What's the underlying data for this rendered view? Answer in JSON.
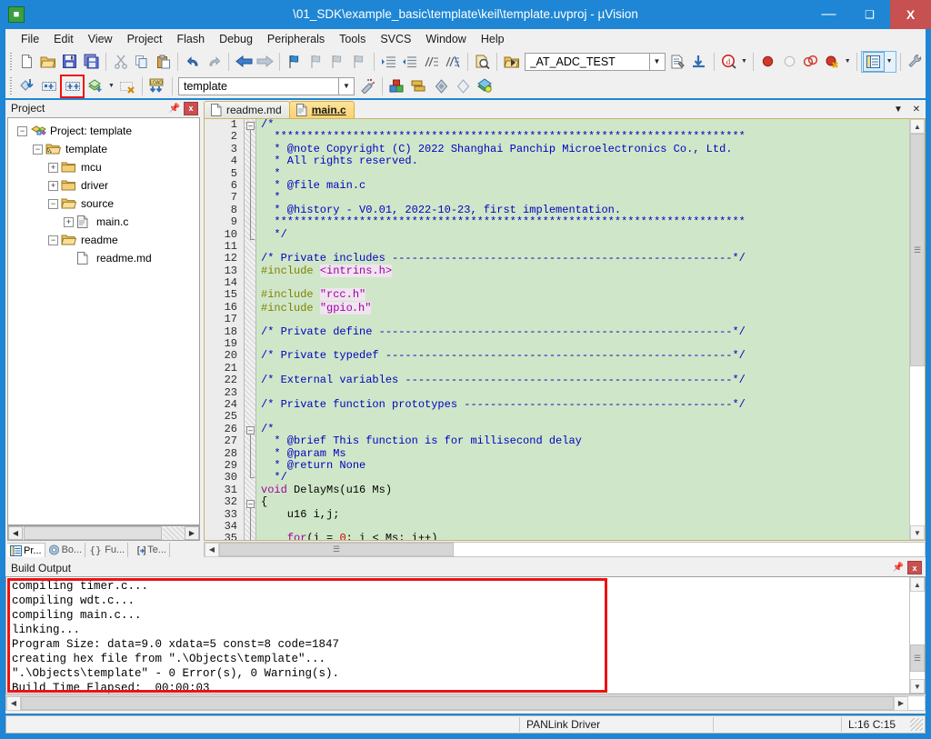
{
  "window": {
    "title": "\\01_SDK\\example_basic\\template\\keil\\template.uvproj - µVision",
    "app_icon": "keil-uvision-icon",
    "minimize": "—",
    "maximize": "❑",
    "close": "X",
    "accent_color": "#1e86d4",
    "close_color": "#c75050"
  },
  "menubar": {
    "items": [
      {
        "label": "File"
      },
      {
        "label": "Edit"
      },
      {
        "label": "View"
      },
      {
        "label": "Project"
      },
      {
        "label": "Flash"
      },
      {
        "label": "Debug"
      },
      {
        "label": "Peripherals"
      },
      {
        "label": "Tools"
      },
      {
        "label": "SVCS"
      },
      {
        "label": "Window"
      },
      {
        "label": "Help"
      }
    ]
  },
  "toolbar_row1": {
    "buttons": [
      {
        "name": "new-file-icon"
      },
      {
        "name": "open-file-icon"
      },
      {
        "name": "save-icon"
      },
      {
        "name": "save-all-icon"
      },
      {
        "name": "cut-icon"
      },
      {
        "name": "copy-icon"
      },
      {
        "name": "paste-icon"
      },
      {
        "name": "undo-icon"
      },
      {
        "name": "redo-icon"
      },
      {
        "name": "navigate-back-icon"
      },
      {
        "name": "navigate-forward-icon"
      },
      {
        "name": "bookmark-toggle-icon"
      },
      {
        "name": "bookmark-prev-icon"
      },
      {
        "name": "bookmark-next-icon"
      },
      {
        "name": "bookmark-clear-icon"
      },
      {
        "name": "indent-increase-icon"
      },
      {
        "name": "indent-decrease-icon"
      },
      {
        "name": "comment-lines-icon"
      },
      {
        "name": "uncomment-lines-icon"
      },
      {
        "name": "find-in-files-icon"
      }
    ]
  },
  "toolbar_row2": {
    "buttons": [
      {
        "name": "translate-file-icon"
      },
      {
        "name": "build-target-icon"
      },
      {
        "name": "rebuild-all-icon",
        "highlighted": true
      },
      {
        "name": "batch-build-icon"
      },
      {
        "name": "stop-build-icon"
      },
      {
        "name": "download-to-flash-icon"
      },
      {
        "name": "target-options-icon"
      },
      {
        "name": "manage-project-items-icon"
      },
      {
        "name": "manage-run-time-env-icon"
      },
      {
        "name": "select-software-packs-icon"
      },
      {
        "name": "pack-installer-icon"
      },
      {
        "name": "multi-project-icon"
      }
    ],
    "target_combo": {
      "value": "template",
      "name": "target-select"
    }
  },
  "toolbar_debug": {
    "open_icon": "start-debug-session-icon",
    "symbol_combo": {
      "value": "_AT_ADC_TEST",
      "name": "symbol-search-combo"
    },
    "buttons": [
      {
        "name": "insert-bookmark-icon"
      },
      {
        "name": "goto-definition-icon"
      },
      {
        "name": "debug-session-icon"
      },
      {
        "name": "insert-breakpoint-icon"
      },
      {
        "name": "disable-breakpoint-icon"
      },
      {
        "name": "kill-all-breakpoints-icon"
      },
      {
        "name": "disable-all-breakpoints-icon"
      },
      {
        "name": "project-window-icon"
      },
      {
        "name": "configuration-wizard-icon"
      }
    ]
  },
  "project_panel": {
    "title": "Project",
    "pin_icon": "pin-icon",
    "close_icon": "close-icon",
    "tree": [
      {
        "indent": 0,
        "expander": "-",
        "icon": "project-icon",
        "label": "Project: template"
      },
      {
        "indent": 1,
        "expander": "-",
        "icon": "target-icon",
        "label": "template"
      },
      {
        "indent": 2,
        "expander": "+",
        "icon": "folder-icon",
        "label": "mcu"
      },
      {
        "indent": 2,
        "expander": "+",
        "icon": "folder-icon",
        "label": "driver"
      },
      {
        "indent": 2,
        "expander": "-",
        "icon": "folder-open-icon",
        "label": "source"
      },
      {
        "indent": 3,
        "expander": "+",
        "icon": "c-file-icon",
        "label": "main.c"
      },
      {
        "indent": 2,
        "expander": "-",
        "icon": "folder-open-icon",
        "label": "readme"
      },
      {
        "indent": 3,
        "expander": "",
        "icon": "file-icon",
        "label": "readme.md"
      }
    ],
    "tabs": [
      {
        "label": "Pr...",
        "icon": "project-tab-icon",
        "active": true
      },
      {
        "label": "Bo...",
        "icon": "books-tab-icon",
        "active": false
      },
      {
        "label": "Fu...",
        "icon": "functions-tab-icon",
        "active": false
      },
      {
        "label": "Te...",
        "icon": "templates-tab-icon",
        "active": false
      }
    ]
  },
  "editor": {
    "tabs": [
      {
        "label": "readme.md",
        "icon": "file-icon",
        "active": false
      },
      {
        "label": "main.c",
        "icon": "c-file-icon",
        "active": true
      }
    ],
    "window_menu_icon": "chevron-down-icon",
    "close_icon": "close-icon",
    "background_color": "#cfe7c8",
    "lines": [
      {
        "n": 1,
        "segs": [
          {
            "t": "/*",
            "c": "cm"
          }
        ]
      },
      {
        "n": 2,
        "segs": [
          {
            "t": "  ************************************************************************",
            "c": "cm"
          }
        ]
      },
      {
        "n": 3,
        "segs": [
          {
            "t": "  * @note Copyright (C) 2022 Shanghai Panchip Microelectronics Co., Ltd.",
            "c": "cm"
          }
        ]
      },
      {
        "n": 4,
        "segs": [
          {
            "t": "  * All rights reserved.",
            "c": "cm"
          }
        ]
      },
      {
        "n": 5,
        "segs": [
          {
            "t": "  *",
            "c": "cm"
          }
        ]
      },
      {
        "n": 6,
        "segs": [
          {
            "t": "  * @file main.c",
            "c": "cm"
          }
        ]
      },
      {
        "n": 7,
        "segs": [
          {
            "t": "  *",
            "c": "cm"
          }
        ]
      },
      {
        "n": 8,
        "segs": [
          {
            "t": "  * @history - V0.01, 2022-10-23, first implementation.",
            "c": "cm"
          }
        ]
      },
      {
        "n": 9,
        "segs": [
          {
            "t": "  ************************************************************************",
            "c": "cm"
          }
        ]
      },
      {
        "n": 10,
        "segs": [
          {
            "t": "  */",
            "c": "cm"
          }
        ]
      },
      {
        "n": 11,
        "segs": []
      },
      {
        "n": 12,
        "segs": [
          {
            "t": "/* Private includes ----------------------------------------------------*/",
            "c": "cm"
          }
        ]
      },
      {
        "n": 13,
        "segs": [
          {
            "t": "#include ",
            "c": "pp"
          },
          {
            "t": "<intrins.h>",
            "c": "str"
          }
        ]
      },
      {
        "n": 14,
        "segs": []
      },
      {
        "n": 15,
        "segs": [
          {
            "t": "#include ",
            "c": "pp"
          },
          {
            "t": "\"rcc.h\"",
            "c": "str"
          }
        ]
      },
      {
        "n": 16,
        "segs": [
          {
            "t": "#include ",
            "c": "pp"
          },
          {
            "t": "\"gpio.h\"",
            "c": "str",
            "caret_at": 5
          }
        ]
      },
      {
        "n": 17,
        "segs": []
      },
      {
        "n": 18,
        "segs": [
          {
            "t": "/* Private define ------------------------------------------------------*/",
            "c": "cm"
          }
        ]
      },
      {
        "n": 19,
        "segs": []
      },
      {
        "n": 20,
        "segs": [
          {
            "t": "/* Private typedef -----------------------------------------------------*/",
            "c": "cm"
          }
        ]
      },
      {
        "n": 21,
        "segs": []
      },
      {
        "n": 22,
        "segs": [
          {
            "t": "/* External variables --------------------------------------------------*/",
            "c": "cm"
          }
        ]
      },
      {
        "n": 23,
        "segs": []
      },
      {
        "n": 24,
        "segs": [
          {
            "t": "/* Private function prototypes -----------------------------------------*/",
            "c": "cm"
          }
        ]
      },
      {
        "n": 25,
        "segs": []
      },
      {
        "n": 26,
        "segs": [
          {
            "t": "/*",
            "c": "cm"
          }
        ]
      },
      {
        "n": 27,
        "segs": [
          {
            "t": "  * @brief This function is for millisecond delay",
            "c": "cm"
          }
        ]
      },
      {
        "n": 28,
        "segs": [
          {
            "t": "  * @param Ms",
            "c": "cm"
          }
        ]
      },
      {
        "n": 29,
        "segs": [
          {
            "t": "  * @return None",
            "c": "cm"
          }
        ]
      },
      {
        "n": 30,
        "segs": [
          {
            "t": "  */",
            "c": "cm"
          }
        ]
      },
      {
        "n": 31,
        "segs": [
          {
            "t": "void",
            "c": "kw"
          },
          {
            "t": " DelayMs(u16 Ms)",
            "c": ""
          }
        ]
      },
      {
        "n": 32,
        "segs": [
          {
            "t": "{",
            "c": ""
          }
        ]
      },
      {
        "n": 33,
        "segs": [
          {
            "t": "    u16 i,j;",
            "c": ""
          }
        ]
      },
      {
        "n": 34,
        "segs": []
      },
      {
        "n": 35,
        "segs": [
          {
            "t": "    ",
            "c": ""
          },
          {
            "t": "for",
            "c": "kw"
          },
          {
            "t": "(i = ",
            "c": ""
          },
          {
            "t": "0",
            "c": "num"
          },
          {
            "t": "; i < Ms; i++)",
            "c": ""
          }
        ]
      }
    ]
  },
  "build_output": {
    "title": "Build Output",
    "pin_icon": "pin-icon",
    "close_icon": "close-icon",
    "highlight_color": "#ee1111",
    "lines": [
      "compiling timer.c...",
      "compiling wdt.c...",
      "compiling main.c...",
      "linking...",
      "Program Size: data=9.0 xdata=5 const=8 code=1847",
      "creating hex file from \".\\Objects\\template\"...",
      "\".\\Objects\\template\" - 0 Error(s), 0 Warning(s).",
      "Build Time Elapsed:  00:00:03"
    ]
  },
  "statusbar": {
    "left": "",
    "driver": "PANLink Driver",
    "middle": "",
    "cursor": "L:16 C:15"
  }
}
